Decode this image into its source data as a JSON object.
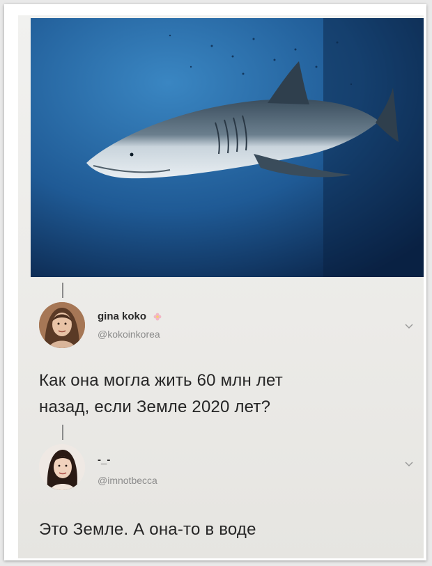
{
  "colors": {
    "ocean_light": "#2f6ea8",
    "ocean_dark": "#0a2347",
    "paper": "#efeeeb",
    "text": "#262626",
    "handle": "#8b8b8b"
  },
  "image": {
    "icon": "shark-photo"
  },
  "tweets": [
    {
      "display_name": "gina koko",
      "handle": "@kokoinkorea",
      "text_line1": "Как она могла жить 60 млн лет",
      "text_line2": "назад, если Земле 2020 лет?"
    },
    {
      "display_name": "-_-",
      "handle": "@imnotbecca",
      "text_line1": "Это Земле. А она-то в воде"
    }
  ]
}
